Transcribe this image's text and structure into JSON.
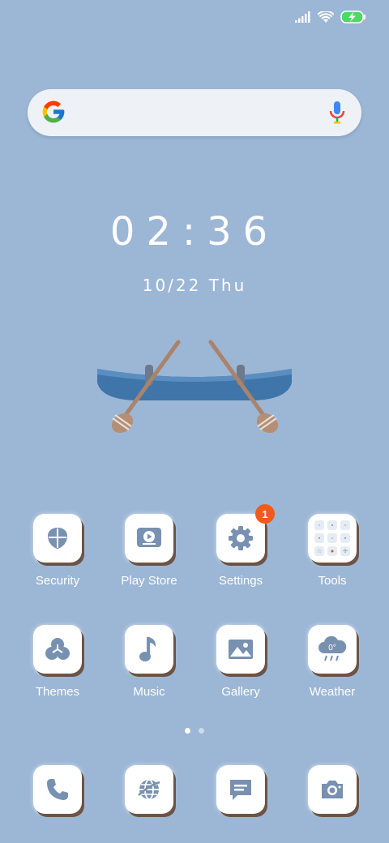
{
  "status": {
    "signal_icon": "signal-icon",
    "wifi_icon": "wifi-icon",
    "battery_icon": "battery-charging-icon"
  },
  "search": {
    "logo_icon": "google-logo-icon",
    "mic_icon": "mic-icon"
  },
  "clock": {
    "time": "02:36",
    "date": "10/22 Thu"
  },
  "apps": [
    {
      "label": "Security",
      "icon": "shield-icon"
    },
    {
      "label": "Play Store",
      "icon": "play-store-icon"
    },
    {
      "label": "Settings",
      "icon": "gear-icon",
      "badge": "1"
    },
    {
      "label": "Tools",
      "icon": "tools-folder-icon"
    },
    {
      "label": "Themes",
      "icon": "themes-icon"
    },
    {
      "label": "Music",
      "icon": "music-note-icon"
    },
    {
      "label": "Gallery",
      "icon": "gallery-icon"
    },
    {
      "label": "Weather",
      "icon": "weather-icon",
      "temp": "0°"
    }
  ],
  "dock": [
    {
      "icon": "phone-icon"
    },
    {
      "icon": "browser-icon"
    },
    {
      "icon": "messages-icon"
    },
    {
      "icon": "camera-icon"
    }
  ],
  "colors": {
    "background": "#9cb6d5",
    "icon_fill": "#7891b1",
    "badge": "#f25a1b",
    "tile": "#ffffff"
  }
}
